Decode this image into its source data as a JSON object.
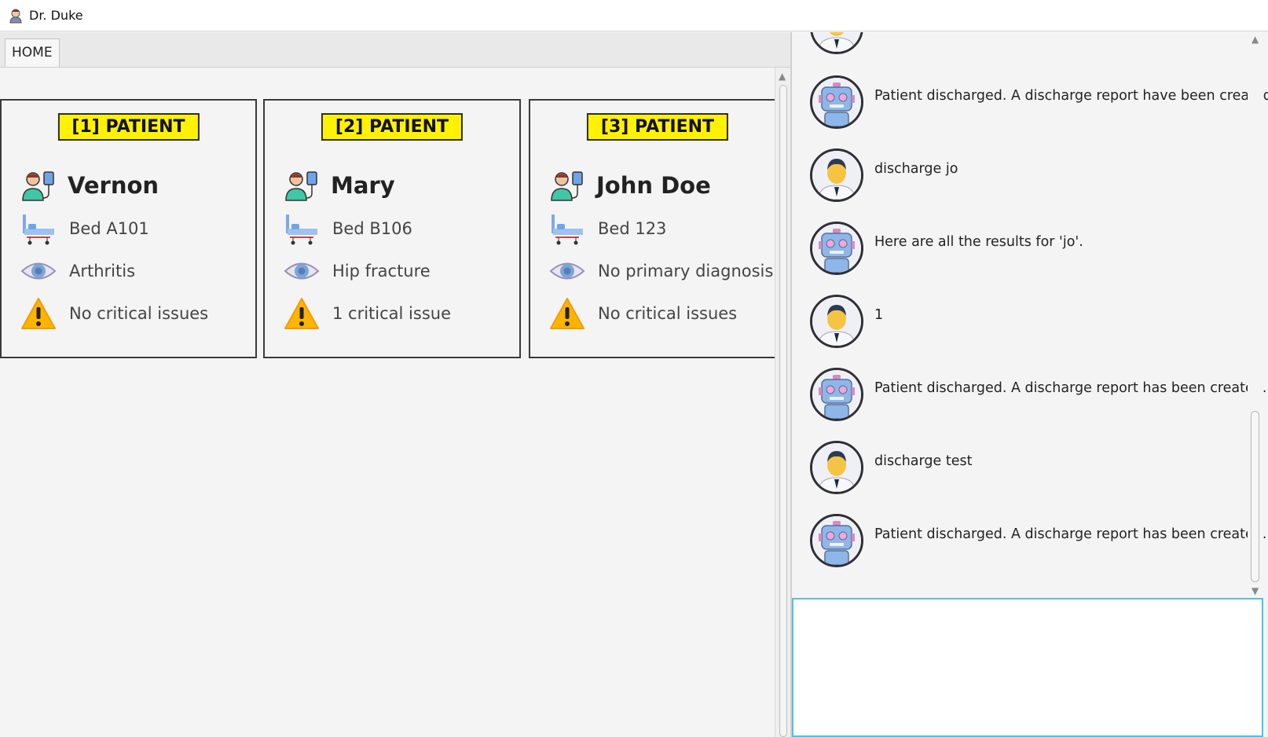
{
  "window": {
    "title": "Dr. Duke"
  },
  "tabs": [
    {
      "label": "HOME"
    }
  ],
  "patients": [
    {
      "badge": "[1] PATIENT",
      "name": "Vernon",
      "bed": "Bed A101",
      "diagnosis": "Arthritis",
      "critical": "No critical issues"
    },
    {
      "badge": "[2] PATIENT",
      "name": "Mary",
      "bed": "Bed B106",
      "diagnosis": "Hip fracture",
      "critical": "1 critical issue"
    },
    {
      "badge": "[3] PATIENT",
      "name": "John Doe",
      "bed": "Bed 123",
      "diagnosis": "No primary diagnosis",
      "critical": "No critical issues"
    }
  ],
  "chat": {
    "messages": [
      {
        "sender": "bot",
        "text": "Patient discharged. A discharge report have been created."
      },
      {
        "sender": "user",
        "text": "discharge jo"
      },
      {
        "sender": "bot",
        "text": "Here are all the results for 'jo'."
      },
      {
        "sender": "user",
        "text": "1"
      },
      {
        "sender": "bot",
        "text": "Patient discharged. A discharge report has been created."
      },
      {
        "sender": "user",
        "text": "discharge test"
      },
      {
        "sender": "bot",
        "text": "Patient discharged. A discharge report has been created."
      }
    ],
    "input_value": ""
  },
  "colors": {
    "badge": "#fff200",
    "input_border": "#4ec3e0"
  },
  "icons": {
    "patient": "patient-icon",
    "bed": "hospital-bed-icon",
    "diagnosis": "eye-icon",
    "critical": "warning-icon",
    "user_avatar": "doctor-avatar-icon",
    "bot_avatar": "robot-avatar-icon"
  }
}
